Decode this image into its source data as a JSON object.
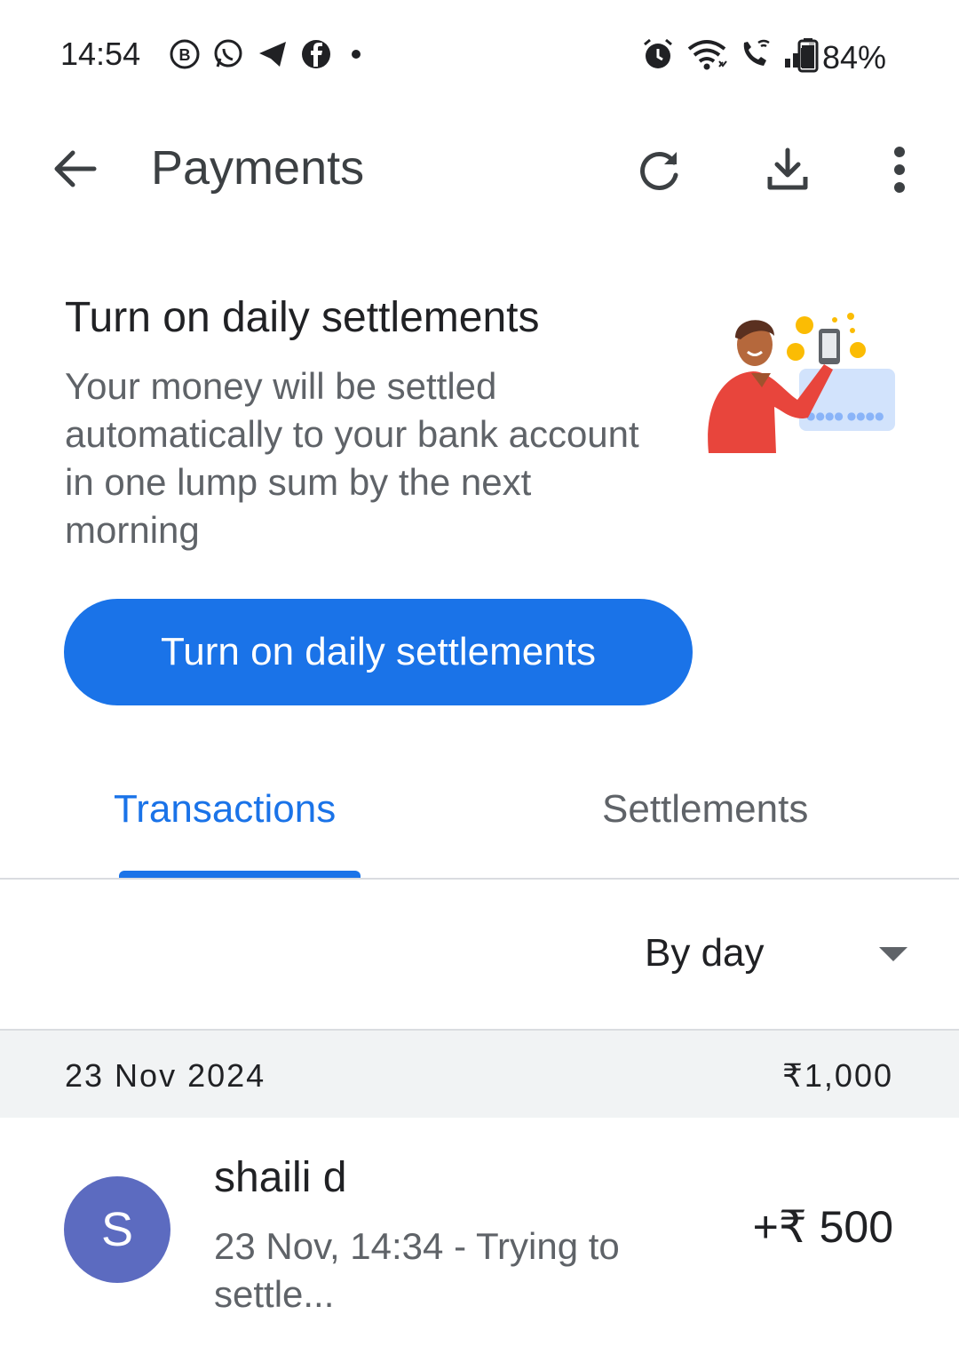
{
  "status_bar": {
    "time": "14:54",
    "battery": "84%",
    "left_icons": [
      "b-badge-icon",
      "whatsapp-icon",
      "telegram-icon",
      "facebook-icon",
      "dot-icon"
    ],
    "right_icons": [
      "alarm-icon",
      "wifi-icon",
      "wifi-calling-icon",
      "signal-icon",
      "battery-icon"
    ]
  },
  "app_bar": {
    "title": "Payments",
    "actions": [
      "back-arrow-icon",
      "refresh-icon",
      "download-icon",
      "more-vert-icon"
    ]
  },
  "promo": {
    "title": "Turn on daily settlements",
    "description": "Your money will be settled automatically to your bank account in one lump sum by the next morning",
    "button_label": "Turn on daily settlements"
  },
  "tabs": [
    {
      "label": "Transactions",
      "selected": true
    },
    {
      "label": "Settlements",
      "selected": false
    }
  ],
  "filter": {
    "label": "By day"
  },
  "groups": [
    {
      "date": "23 Nov 2024",
      "total": "₹1,000",
      "transactions": [
        {
          "avatar_letter": "S",
          "name": "shaili d",
          "subtitle": "23 Nov, 14:34 - Trying to settle...",
          "amount": "+₹ 500"
        }
      ]
    }
  ],
  "colors": {
    "accent": "#1a73e8",
    "avatar": "#5c6bc0",
    "group_header_bg": "#f1f3f4"
  }
}
